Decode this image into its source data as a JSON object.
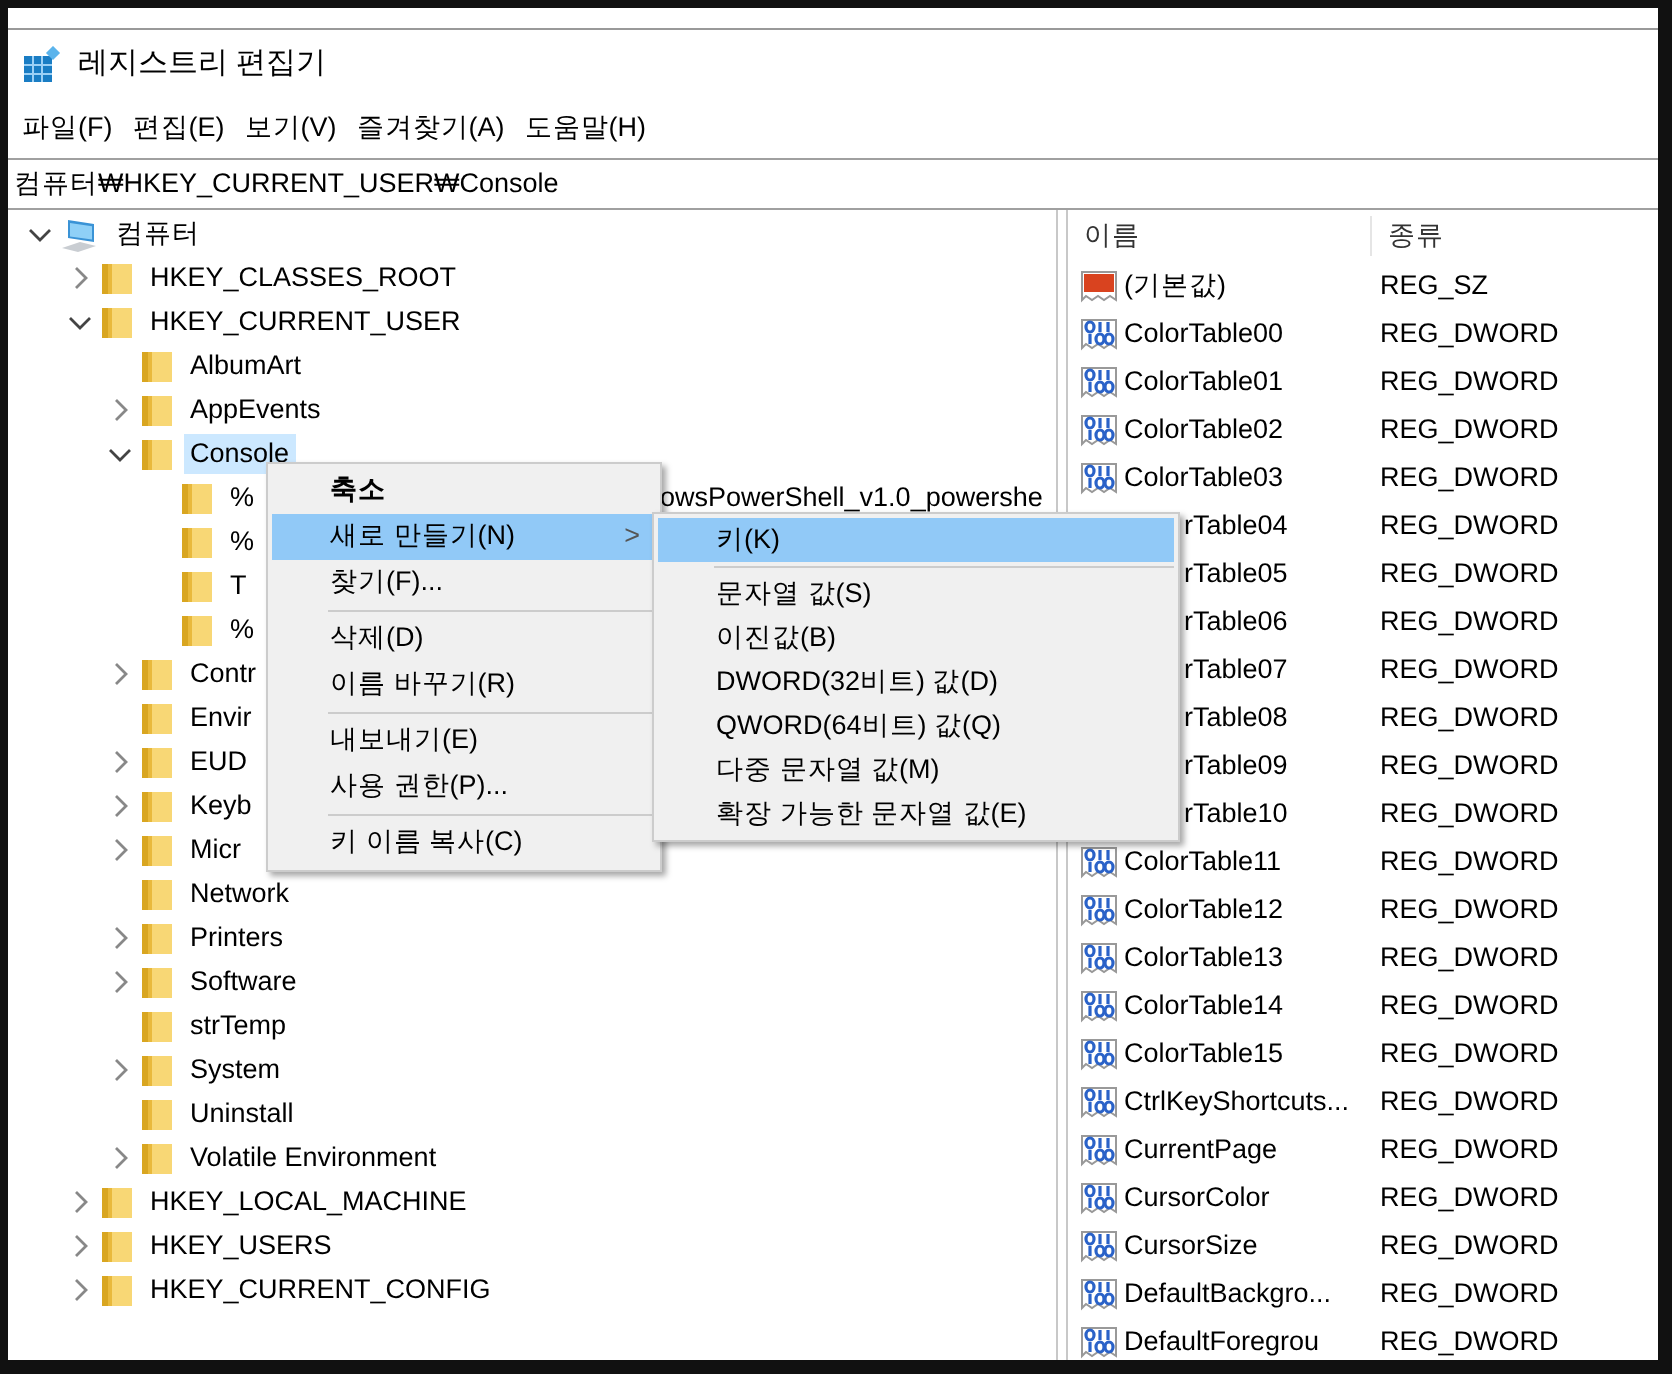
{
  "window": {
    "title": "레지스트리 편집기"
  },
  "menu_bar": [
    "파일(F)",
    "편집(E)",
    "보기(V)",
    "즐겨찾기(A)",
    "도움말(H)"
  ],
  "address": "컴퓨터₩HKEY_CURRENT_USER₩Console",
  "tree": [
    {
      "label": "컴퓨터",
      "kind": "computer",
      "expandable": true,
      "expanded": true,
      "selected": false,
      "children": [
        {
          "label": "HKEY_CLASSES_ROOT",
          "expandable": true,
          "expanded": false,
          "selected": false
        },
        {
          "label": "HKEY_CURRENT_USER",
          "expandable": true,
          "expanded": true,
          "selected": false,
          "children": [
            {
              "label": "AlbumArt",
              "expandable": false,
              "selected": false
            },
            {
              "label": "AppEvents",
              "expandable": true,
              "expanded": false,
              "selected": false
            },
            {
              "label": "Console",
              "expandable": true,
              "expanded": true,
              "selected": true,
              "children": [
                {
                  "label": "%",
                  "tail": "owsPowerShell_v1.0_powershe",
                  "expandable": false,
                  "selected": false
                },
                {
                  "label": "%",
                  "expandable": false,
                  "selected": false
                },
                {
                  "label": "T",
                  "expandable": false,
                  "selected": false
                },
                {
                  "label": "%",
                  "expandable": false,
                  "selected": false
                }
              ]
            },
            {
              "label": "Contr",
              "expandable": true,
              "expanded": false,
              "selected": false
            },
            {
              "label": "Envir",
              "expandable": false,
              "selected": false
            },
            {
              "label": "EUD",
              "expandable": true,
              "expanded": false,
              "selected": false
            },
            {
              "label": "Keyb",
              "expandable": true,
              "expanded": false,
              "selected": false
            },
            {
              "label": "Micr",
              "expandable": true,
              "expanded": false,
              "selected": false
            },
            {
              "label": "Network",
              "expandable": false,
              "selected": false
            },
            {
              "label": "Printers",
              "expandable": true,
              "expanded": false,
              "selected": false
            },
            {
              "label": "Software",
              "expandable": true,
              "expanded": false,
              "selected": false
            },
            {
              "label": "strTemp",
              "expandable": false,
              "selected": false
            },
            {
              "label": "System",
              "expandable": true,
              "expanded": false,
              "selected": false
            },
            {
              "label": "Uninstall",
              "expandable": false,
              "selected": false
            },
            {
              "label": "Volatile Environment",
              "expandable": true,
              "expanded": false,
              "selected": false
            }
          ]
        },
        {
          "label": "HKEY_LOCAL_MACHINE",
          "expandable": true,
          "expanded": false,
          "selected": false
        },
        {
          "label": "HKEY_USERS",
          "expandable": true,
          "expanded": false,
          "selected": false
        },
        {
          "label": "HKEY_CURRENT_CONFIG",
          "expandable": true,
          "expanded": false,
          "selected": false
        }
      ]
    }
  ],
  "values": {
    "columns": [
      "이름",
      "종류"
    ],
    "rows": [
      {
        "name": "(기본값)",
        "type": "REG_SZ",
        "kind": "string"
      },
      {
        "name": "ColorTable00",
        "type": "REG_DWORD",
        "kind": "binary"
      },
      {
        "name": "ColorTable01",
        "type": "REG_DWORD",
        "kind": "binary"
      },
      {
        "name": "ColorTable02",
        "type": "REG_DWORD",
        "kind": "binary"
      },
      {
        "name": "ColorTable03",
        "type": "REG_DWORD",
        "kind": "binary"
      },
      {
        "name": "rTable04",
        "type": "REG_DWORD",
        "kind": "covered"
      },
      {
        "name": "rTable05",
        "type": "REG_DWORD",
        "kind": "covered"
      },
      {
        "name": "rTable06",
        "type": "REG_DWORD",
        "kind": "covered"
      },
      {
        "name": "rTable07",
        "type": "REG_DWORD",
        "kind": "covered"
      },
      {
        "name": "rTable08",
        "type": "REG_DWORD",
        "kind": "covered"
      },
      {
        "name": "rTable09",
        "type": "REG_DWORD",
        "kind": "covered"
      },
      {
        "name": "rTable10",
        "type": "REG_DWORD",
        "kind": "covered"
      },
      {
        "name": "ColorTable11",
        "type": "REG_DWORD",
        "kind": "binary"
      },
      {
        "name": "ColorTable12",
        "type": "REG_DWORD",
        "kind": "binary"
      },
      {
        "name": "ColorTable13",
        "type": "REG_DWORD",
        "kind": "binary"
      },
      {
        "name": "ColorTable14",
        "type": "REG_DWORD",
        "kind": "binary"
      },
      {
        "name": "ColorTable15",
        "type": "REG_DWORD",
        "kind": "binary"
      },
      {
        "name": "CtrlKeyShortcuts...",
        "type": "REG_DWORD",
        "kind": "binary"
      },
      {
        "name": "CurrentPage",
        "type": "REG_DWORD",
        "kind": "binary"
      },
      {
        "name": "CursorColor",
        "type": "REG_DWORD",
        "kind": "binary"
      },
      {
        "name": "CursorSize",
        "type": "REG_DWORD",
        "kind": "binary"
      },
      {
        "name": "DefaultBackgro...",
        "type": "REG_DWORD",
        "kind": "binary"
      },
      {
        "name": "DefaultForegrou",
        "type": "REG_DWORD",
        "kind": "binary"
      }
    ]
  },
  "context_menu": [
    {
      "label": "축소",
      "kind": "item",
      "default": true,
      "selected": false
    },
    {
      "label": "새로 만들기(N)",
      "kind": "submenu",
      "default": false,
      "selected": true,
      "arrow": ">"
    },
    {
      "label": "찾기(F)...",
      "kind": "item",
      "default": false,
      "selected": false
    },
    {
      "kind": "separator"
    },
    {
      "label": "삭제(D)",
      "kind": "item",
      "default": false,
      "selected": false
    },
    {
      "label": "이름 바꾸기(R)",
      "kind": "item",
      "default": false,
      "selected": false
    },
    {
      "kind": "separator"
    },
    {
      "label": "내보내기(E)",
      "kind": "item",
      "default": false,
      "selected": false
    },
    {
      "label": "사용 권한(P)...",
      "kind": "item",
      "default": false,
      "selected": false
    },
    {
      "kind": "separator"
    },
    {
      "label": "키 이름 복사(C)",
      "kind": "item",
      "default": false,
      "selected": false
    }
  ],
  "submenu": [
    {
      "label": "키(K)",
      "kind": "item",
      "selected": true
    },
    {
      "kind": "separator"
    },
    {
      "label": "문자열 값(S)",
      "kind": "item",
      "selected": false
    },
    {
      "label": "이진값(B)",
      "kind": "item",
      "selected": false
    },
    {
      "label": "DWORD(32비트) 값(D)",
      "kind": "item",
      "selected": false
    },
    {
      "label": "QWORD(64비트) 값(Q)",
      "kind": "item",
      "selected": false
    },
    {
      "label": "다중 문자열 값(M)",
      "kind": "item",
      "selected": false
    },
    {
      "label": "확장 가능한 문자열 값(E)",
      "kind": "item",
      "selected": false
    }
  ]
}
